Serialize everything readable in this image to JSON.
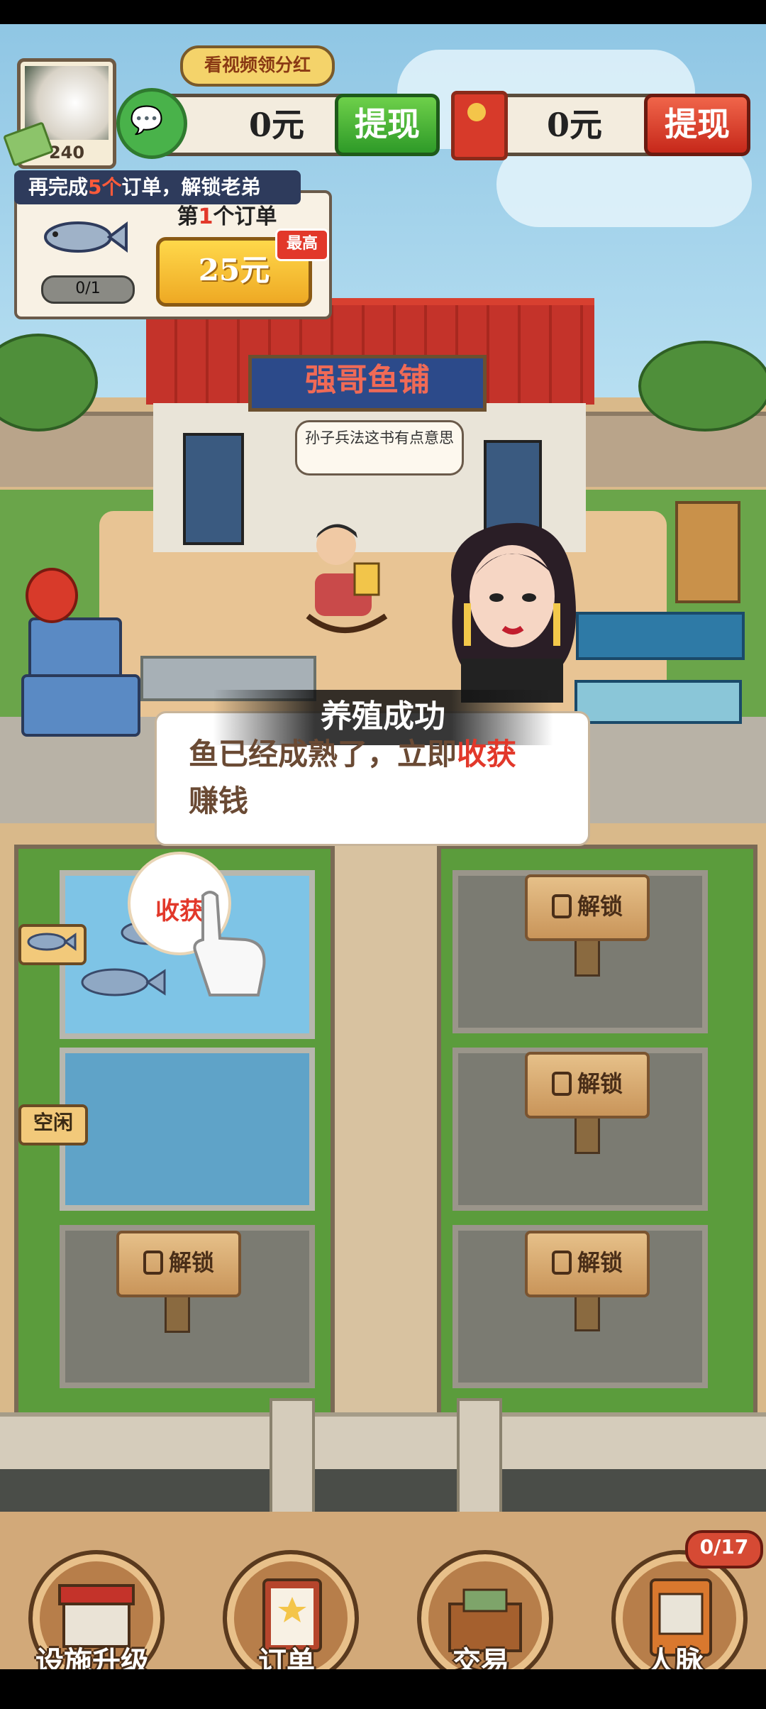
{
  "player": {
    "level": "240"
  },
  "header": {
    "video_tip": "看视频领分红",
    "wechat_amount": "0元",
    "wechat_withdraw": "提现",
    "redpacket_amount": "0元",
    "redpacket_withdraw": "提现"
  },
  "order": {
    "banner_pre": "再完成",
    "banner_count": "5个",
    "banner_post": "订单，解锁老弟",
    "progress": "0/1",
    "order_no_pre": "第",
    "order_no_num": "1",
    "order_no_post": "个订单",
    "reward": "25元",
    "max_tag": "最高"
  },
  "shop": {
    "sign": "强哥鱼铺",
    "speech": "孙子兵法这书有点意思"
  },
  "popup": {
    "title": "养殖成功",
    "text_pre": "鱼已经成熟了，立即",
    "text_highlight": "收获",
    "text_post": "赚钱"
  },
  "ponds": {
    "harvest_label": "收获",
    "idle_label": "空闲",
    "unlock_label": "解锁"
  },
  "nav": {
    "facility": "设施升级",
    "orders": "订单",
    "trade": "交易",
    "contacts": "人脉",
    "contacts_badge": "0/17"
  },
  "colors": {
    "accent_red": "#e2382a",
    "withdraw_green": "#2e9a28",
    "order_gold": "#eea924"
  }
}
